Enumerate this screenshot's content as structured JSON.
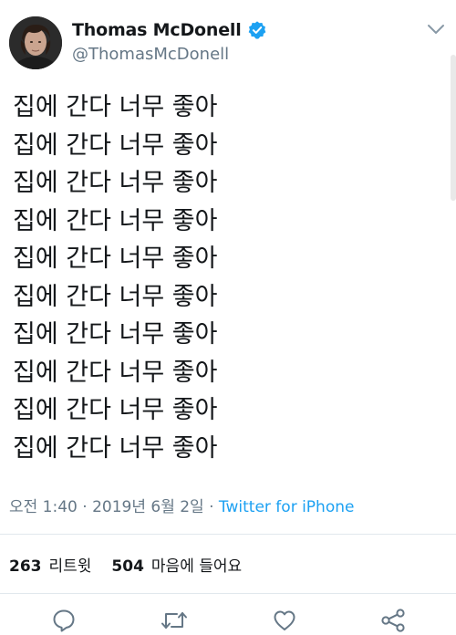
{
  "author": {
    "display_name": "Thomas McDonell",
    "handle": "@ThomasMcDonell",
    "verified_icon": "verified-badge-icon"
  },
  "tweet": {
    "lines": [
      "집에 간다 너무 좋아",
      "집에 간다 너무 좋아",
      "집에 간다 너무 좋아",
      "집에 간다 너무 좋아",
      "집에 간다 너무 좋아",
      "집에 간다 너무 좋아",
      "집에 간다 너무 좋아",
      "집에 간다 너무 좋아",
      "집에 간다 너무 좋아",
      "집에 간다 너무 좋아"
    ]
  },
  "meta": {
    "time": "오전 1:40",
    "separator1": " · ",
    "date": "2019년 6월 2일",
    "separator2": " · ",
    "source": "Twitter for iPhone"
  },
  "stats": {
    "retweets": "263",
    "retweets_label": "리트윗",
    "likes": "504",
    "likes_label": "마음에 들어요"
  },
  "icons": {
    "menu": "chevron-down-icon",
    "reply": "reply-icon",
    "retweet": "retweet-icon",
    "like": "heart-icon",
    "share": "share-icon"
  },
  "colors": {
    "accent": "#1da1f2",
    "secondary_text": "#657786",
    "primary_text": "#14171a",
    "divider": "#e1e8ed"
  }
}
